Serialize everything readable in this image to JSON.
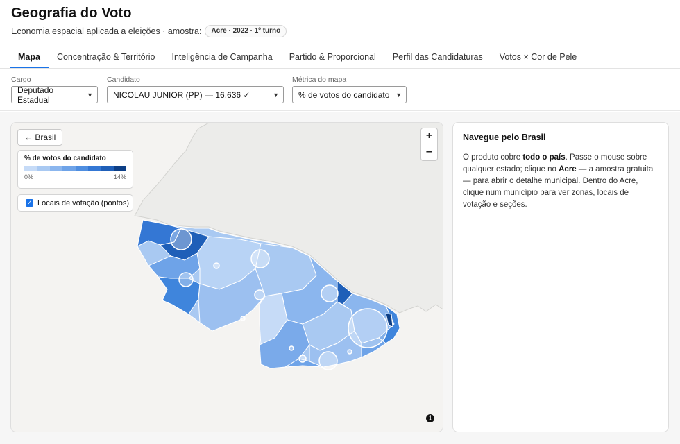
{
  "app": {
    "title": "Geografia do Voto",
    "subtitle": "Economia espacial aplicada a eleições · amostra:",
    "sample_badge": "Acre · 2022 · 1º turno"
  },
  "tabs": [
    {
      "label": "Mapa",
      "active": true
    },
    {
      "label": "Concentração & Território",
      "active": false
    },
    {
      "label": "Inteligência de Campanha",
      "active": false
    },
    {
      "label": "Partido & Proporcional",
      "active": false
    },
    {
      "label": "Perfil das Candidaturas",
      "active": false
    },
    {
      "label": "Votos × Cor de Pele",
      "active": false
    }
  ],
  "filters": {
    "cargo": {
      "label": "Cargo",
      "value": "Deputado Estadual"
    },
    "candidato": {
      "label": "Candidato",
      "value": "NICOLAU JUNIOR (PP) — 16.636 ✓"
    },
    "metrica": {
      "label": "Métrica do mapa",
      "value": "% de votos do candidato"
    }
  },
  "map": {
    "back_label": "← Brasil",
    "legend": {
      "title": "% de votos do candidato",
      "min_label": "0%",
      "max_label": "14%",
      "colors": [
        "#c6dbf7",
        "#a9c9f2",
        "#8bb6ee",
        "#6ea3e8",
        "#4f8ee0",
        "#3477d4",
        "#1f5fb8",
        "#0d3f86"
      ]
    },
    "points_toggle": {
      "label": "Locais de votação  (pontos)",
      "checked": true
    },
    "zoom_in": "+",
    "zoom_out": "−",
    "info": "i"
  },
  "side_panel": {
    "title": "Navegue pelo Brasil",
    "body_parts": [
      {
        "text": "O produto cobre ",
        "bold": false
      },
      {
        "text": "todo o país",
        "bold": true
      },
      {
        "text": ". Passe o mouse sobre qualquer estado; clique no ",
        "bold": false
      },
      {
        "text": "Acre",
        "bold": true
      },
      {
        "text": " — a amostra gratuita — para abrir o detalhe municipal. Dentro do Acre, clique num município para ver zonas, locais de votação e seções.",
        "bold": false
      }
    ]
  },
  "colors": {
    "accent": "#1a73e8",
    "map_background": "#f4f3f1",
    "neighbor_fill": "#eeeeee"
  }
}
